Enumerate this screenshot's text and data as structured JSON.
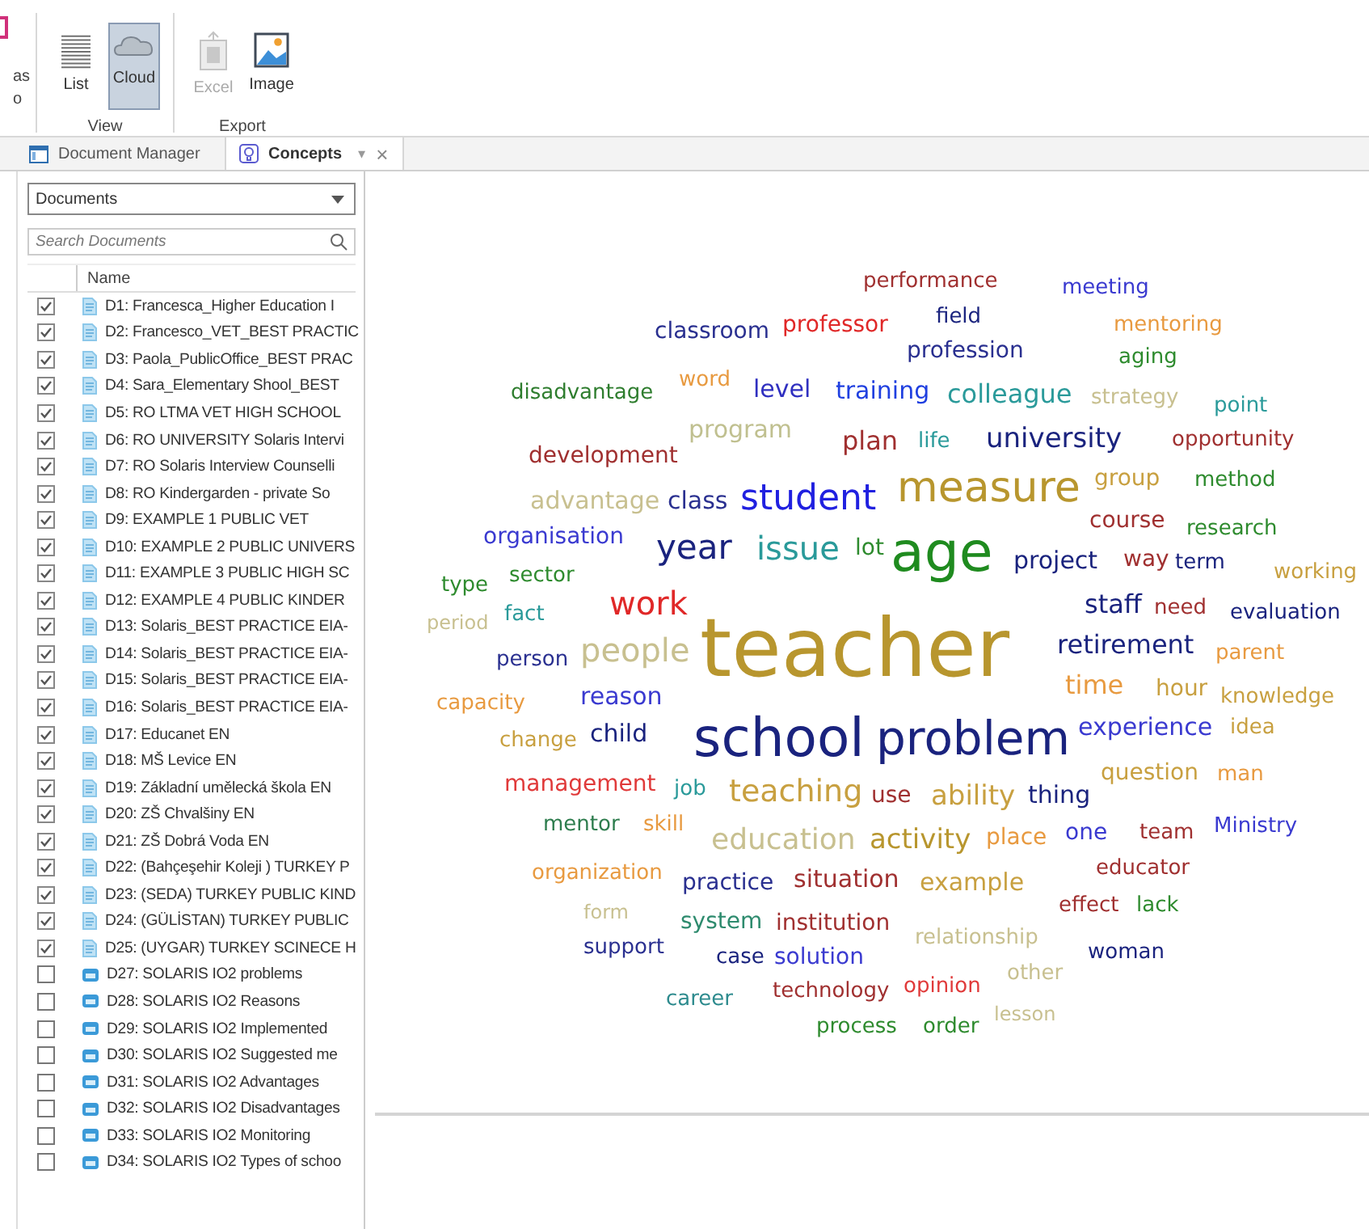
{
  "ribbon": {
    "cut_group": {
      "lines": [
        "as",
        "o"
      ]
    },
    "groups": [
      {
        "label": "View",
        "buttons": [
          {
            "label": "List",
            "kind": "list",
            "selected": false,
            "disabled": false
          },
          {
            "label": "Cloud",
            "kind": "cloud",
            "selected": true,
            "disabled": false
          }
        ]
      },
      {
        "label": "Export",
        "buttons": [
          {
            "label": "Excel",
            "kind": "excel",
            "selected": false,
            "disabled": true
          },
          {
            "label": "Image",
            "kind": "image",
            "selected": false,
            "disabled": false
          }
        ]
      }
    ]
  },
  "tabs": [
    {
      "label": "Document Manager",
      "kind": "manager",
      "selected": false
    },
    {
      "label": "Concepts",
      "kind": "concepts",
      "selected": true,
      "menu": "▾",
      "close": "×"
    }
  ],
  "documents": {
    "dropdown": "Documents",
    "search": {
      "placeholder": "Search Documents"
    },
    "column": "Name",
    "rows": [
      {
        "name": "D1: Francesca_Higher Education I",
        "kind": "text",
        "checked": true
      },
      {
        "name": "D2: Francesco_VET_BEST PRACTIC",
        "kind": "text",
        "checked": true
      },
      {
        "name": "D3: Paola_PublicOffice_BEST PRAC",
        "kind": "text",
        "checked": true
      },
      {
        "name": "D4: Sara_Elementary Shool_BEST",
        "kind": "text",
        "checked": true
      },
      {
        "name": "D5: RO LTMA VET HIGH SCHOOL",
        "kind": "text",
        "checked": true
      },
      {
        "name": "D6: RO UNIVERSITY Solaris Intervi",
        "kind": "text",
        "checked": true
      },
      {
        "name": "D7: RO Solaris Interview Counselli",
        "kind": "text",
        "checked": true
      },
      {
        "name": "D8: RO Kindergarden - private So",
        "kind": "text",
        "checked": true
      },
      {
        "name": "D9: EXAMPLE 1 PUBLIC VET",
        "kind": "text",
        "checked": true
      },
      {
        "name": "D10: EXAMPLE 2 PUBLIC UNIVERS",
        "kind": "text",
        "checked": true
      },
      {
        "name": "D11: EXAMPLE 3 PUBLIC HIGH SC",
        "kind": "text",
        "checked": true
      },
      {
        "name": "D12: EXAMPLE 4 PUBLIC KINDER",
        "kind": "text",
        "checked": true
      },
      {
        "name": "D13: Solaris_BEST PRACTICE EIA-",
        "kind": "text",
        "checked": true
      },
      {
        "name": "D14: Solaris_BEST PRACTICE EIA-",
        "kind": "text",
        "checked": true
      },
      {
        "name": "D15: Solaris_BEST PRACTICE EIA-",
        "kind": "text",
        "checked": true
      },
      {
        "name": "D16: Solaris_BEST PRACTICE EIA-",
        "kind": "text",
        "checked": true
      },
      {
        "name": "D17: Educanet EN",
        "kind": "text",
        "checked": true
      },
      {
        "name": "D18: MŠ Levice EN",
        "kind": "text",
        "checked": true
      },
      {
        "name": "D19: Základní umělecká škola EN",
        "kind": "text",
        "checked": true
      },
      {
        "name": "D20: ZŠ Chvalšiny EN",
        "kind": "text",
        "checked": true
      },
      {
        "name": "D21: ZŠ Dobrá Voda EN",
        "kind": "text",
        "checked": true
      },
      {
        "name": "D22: (Bahçeşehir Koleji ) TURKEY P",
        "kind": "text",
        "checked": true
      },
      {
        "name": "D23: (SEDA) TURKEY PUBLIC KIND",
        "kind": "text",
        "checked": true
      },
      {
        "name": "D24: (GÜLİSTAN) TURKEY PUBLIC",
        "kind": "text",
        "checked": true
      },
      {
        "name": "D25: (UYGAR) TURKEY SCINECE H",
        "kind": "text",
        "checked": true
      },
      {
        "name": "D27: SOLARIS IO2 problems",
        "kind": "dataset",
        "checked": false
      },
      {
        "name": "D28: SOLARIS IO2 Reasons",
        "kind": "dataset",
        "checked": false
      },
      {
        "name": "D29: SOLARIS IO2 Implemented",
        "kind": "dataset",
        "checked": false
      },
      {
        "name": "D30: SOLARIS IO2 Suggested me",
        "kind": "dataset",
        "checked": false
      },
      {
        "name": "D31: SOLARIS IO2 Advantages",
        "kind": "dataset",
        "checked": false
      },
      {
        "name": "D32: SOLARIS IO2 Disadvantages",
        "kind": "dataset",
        "checked": false
      },
      {
        "name": "D33: SOLARIS IO2 Monitoring",
        "kind": "dataset",
        "checked": false
      },
      {
        "name": "D34: SOLARIS IO2 Types of schoo",
        "kind": "dataset",
        "checked": false
      }
    ]
  },
  "cloud": {
    "words": [
      {
        "text": "performance",
        "color": "#a03030"
      },
      {
        "text": "meeting",
        "color": "#3a3ad0"
      },
      {
        "text": "classroom",
        "color": "#2a3090"
      },
      {
        "text": "professor",
        "color": "#e02828"
      },
      {
        "text": "field",
        "color": "#1a237e"
      },
      {
        "text": "mentoring",
        "color": "#e89a40"
      },
      {
        "text": "profession",
        "color": "#2a3090"
      },
      {
        "text": "aging",
        "color": "#2e8b2e"
      },
      {
        "text": "disadvantage",
        "color": "#2e7d2e"
      },
      {
        "text": "word",
        "color": "#e89a40"
      },
      {
        "text": "level",
        "color": "#3030c0"
      },
      {
        "text": "training",
        "color": "#2040e0"
      },
      {
        "text": "colleague",
        "color": "#2a9a9a"
      },
      {
        "text": "strategy",
        "color": "#c8c090"
      },
      {
        "text": "point",
        "color": "#2a9a9a"
      },
      {
        "text": "program",
        "color": "#c0c090"
      },
      {
        "text": "plan",
        "color": "#a03030"
      },
      {
        "text": "life",
        "color": "#2a9a9a"
      },
      {
        "text": "university",
        "color": "#1a237e"
      },
      {
        "text": "opportunity",
        "color": "#a03030"
      },
      {
        "text": "development",
        "color": "#a03030"
      },
      {
        "text": "advantage",
        "color": "#c8c090"
      },
      {
        "text": "class",
        "color": "#2a3090"
      },
      {
        "text": "student",
        "color": "#2020e0"
      },
      {
        "text": "measure",
        "color": "#b8962e"
      },
      {
        "text": "group",
        "color": "#c8a040"
      },
      {
        "text": "method",
        "color": "#2e8b2e"
      },
      {
        "text": "course",
        "color": "#a03030"
      },
      {
        "text": "organisation",
        "color": "#3a3ad0"
      },
      {
        "text": "research",
        "color": "#2e8b2e"
      },
      {
        "text": "year",
        "color": "#1a237e"
      },
      {
        "text": "issue",
        "color": "#2a9a9a"
      },
      {
        "text": "lot",
        "color": "#2e8b2e"
      },
      {
        "text": "age",
        "color": "#1f8b1f"
      },
      {
        "text": "project",
        "color": "#1a237e"
      },
      {
        "text": "way",
        "color": "#a03030"
      },
      {
        "text": "term",
        "color": "#1a237e"
      },
      {
        "text": "working",
        "color": "#c8a040"
      },
      {
        "text": "type",
        "color": "#2e8b2e"
      },
      {
        "text": "sector",
        "color": "#2e8b2e"
      },
      {
        "text": "fact",
        "color": "#2a9a9a"
      },
      {
        "text": "work",
        "color": "#e02828"
      },
      {
        "text": "staff",
        "color": "#1a237e"
      },
      {
        "text": "need",
        "color": "#a03030"
      },
      {
        "text": "evaluation",
        "color": "#1a237e"
      },
      {
        "text": "period",
        "color": "#c8c090"
      },
      {
        "text": "person",
        "color": "#2a3090"
      },
      {
        "text": "people",
        "color": "#c8c090"
      },
      {
        "text": "teacher",
        "color": "#b8962e"
      },
      {
        "text": "retirement",
        "color": "#1a237e"
      },
      {
        "text": "parent",
        "color": "#e89a40"
      },
      {
        "text": "capacity",
        "color": "#e89a40"
      },
      {
        "text": "reason",
        "color": "#3a3ad0"
      },
      {
        "text": "time",
        "color": "#e89a40"
      },
      {
        "text": "hour",
        "color": "#c8a040"
      },
      {
        "text": "knowledge",
        "color": "#c8a040"
      },
      {
        "text": "change",
        "color": "#c8a040"
      },
      {
        "text": "child",
        "color": "#1a237e"
      },
      {
        "text": "school",
        "color": "#1a237e"
      },
      {
        "text": "problem",
        "color": "#1a237e"
      },
      {
        "text": "experience",
        "color": "#3a3ad0"
      },
      {
        "text": "idea",
        "color": "#c8a040"
      },
      {
        "text": "management",
        "color": "#e03a3a"
      },
      {
        "text": "job",
        "color": "#2a9a9a"
      },
      {
        "text": "teaching",
        "color": "#c8a040"
      },
      {
        "text": "use",
        "color": "#a03030"
      },
      {
        "text": "ability",
        "color": "#c8a040"
      },
      {
        "text": "thing",
        "color": "#1a237e"
      },
      {
        "text": "question",
        "color": "#c8a040"
      },
      {
        "text": "man",
        "color": "#e89a40"
      },
      {
        "text": "mentor",
        "color": "#2e7d4e"
      },
      {
        "text": "skill",
        "color": "#e89a40"
      },
      {
        "text": "education",
        "color": "#c8c090"
      },
      {
        "text": "activity",
        "color": "#b8962e"
      },
      {
        "text": "place",
        "color": "#e89a40"
      },
      {
        "text": "one",
        "color": "#3a3ad0"
      },
      {
        "text": "team",
        "color": "#a03030"
      },
      {
        "text": "Ministry",
        "color": "#3a3ad0"
      },
      {
        "text": "organization",
        "color": "#e89a40"
      },
      {
        "text": "practice",
        "color": "#2a3090"
      },
      {
        "text": "situation",
        "color": "#a03030"
      },
      {
        "text": "example",
        "color": "#c8a040"
      },
      {
        "text": "educator",
        "color": "#a03030"
      },
      {
        "text": "form",
        "color": "#c8c090"
      },
      {
        "text": "system",
        "color": "#2e8b6e"
      },
      {
        "text": "institution",
        "color": "#a03030"
      },
      {
        "text": "effect",
        "color": "#a03030"
      },
      {
        "text": "lack",
        "color": "#2e8b2e"
      },
      {
        "text": "relationship",
        "color": "#c8c090"
      },
      {
        "text": "support",
        "color": "#2a3090"
      },
      {
        "text": "case",
        "color": "#1a237e"
      },
      {
        "text": "solution",
        "color": "#3a3ad0"
      },
      {
        "text": "woman",
        "color": "#1a237e"
      },
      {
        "text": "other",
        "color": "#c8c090"
      },
      {
        "text": "career",
        "color": "#2e8b8e"
      },
      {
        "text": "technology",
        "color": "#a03030"
      },
      {
        "text": "opinion",
        "color": "#e03a3a"
      },
      {
        "text": "lesson",
        "color": "#c8c090"
      },
      {
        "text": "process",
        "color": "#2e8b2e"
      },
      {
        "text": "order",
        "color": "#2e8b2e"
      }
    ]
  }
}
